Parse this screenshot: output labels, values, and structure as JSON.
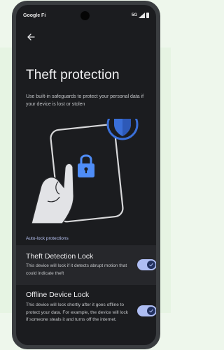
{
  "status_bar": {
    "carrier": "Google Fi",
    "network": "5G"
  },
  "page": {
    "title": "Theft protection",
    "description": "Use built-in safeguards to protect your personal data if your device is lost or stolen",
    "back_icon": "arrow-left-icon"
  },
  "illustration": {
    "icons": [
      "hand-holding-phone",
      "lock-icon",
      "shield-icon"
    ]
  },
  "section": {
    "label": "Auto-lock protections"
  },
  "settings": [
    {
      "title": "Theft Detection Lock",
      "subtitle": "This device will lock if it detects abrupt motion that could indicate theft",
      "enabled": true
    },
    {
      "title": "Offline Device Lock",
      "subtitle": "This device will lock shortly after it goes offline to protect your data. For example, the device will lock if someone steals it and turns off the internet.",
      "enabled": true
    }
  ],
  "colors": {
    "screen_bg": "#1b1c1f",
    "highlight_row": "#26272b",
    "accent": "#aebdf3",
    "section_label": "#b9c4f5",
    "shield": "#3a6fd8",
    "lock": "#4f8df7",
    "panel_bg": "#eef7ec"
  }
}
